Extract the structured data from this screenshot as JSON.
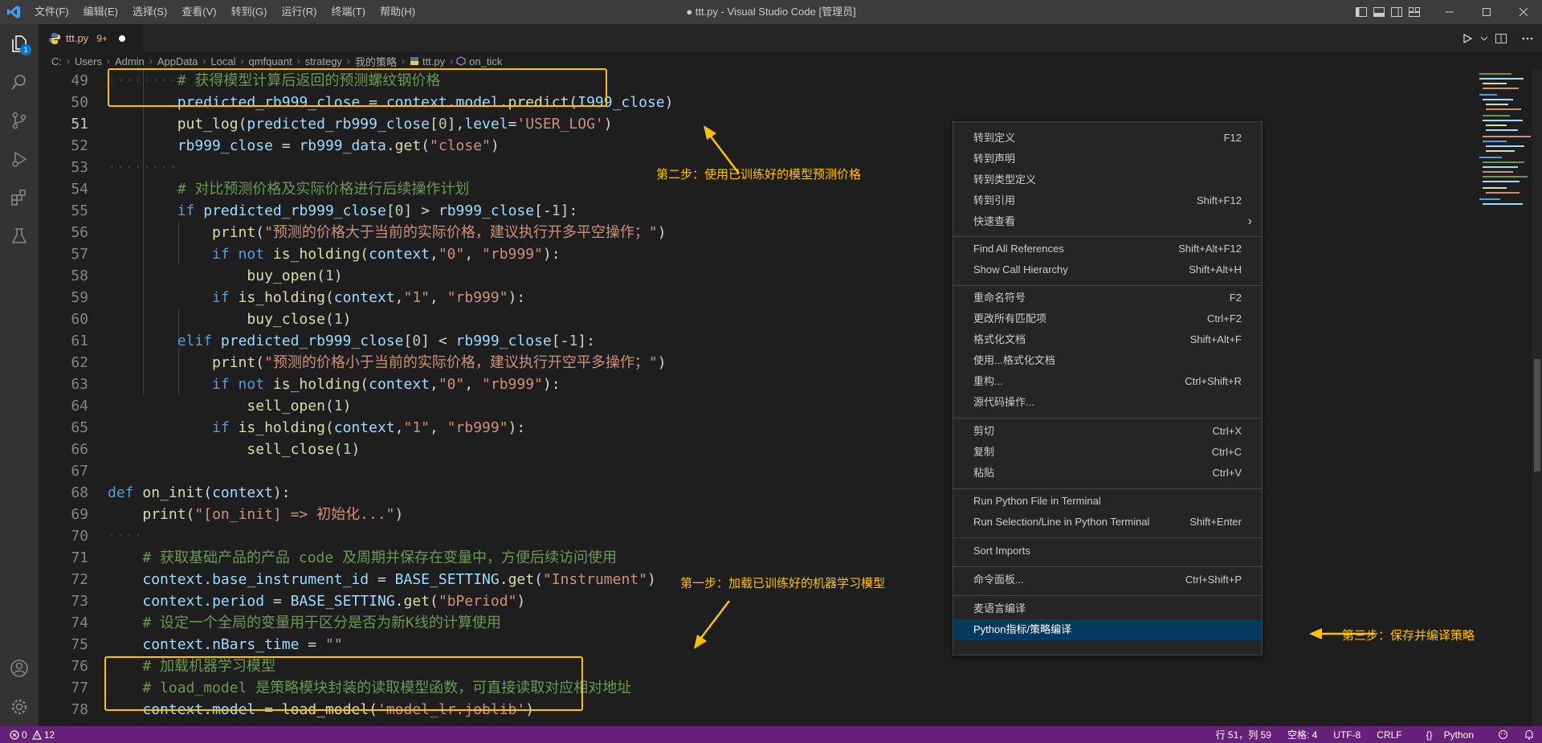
{
  "window": {
    "title": "● ttt.py - Visual Studio Code [管理员]",
    "menu": [
      "文件(F)",
      "编辑(E)",
      "选择(S)",
      "查看(V)",
      "转到(G)",
      "运行(R)",
      "终端(T)",
      "帮助(H)"
    ]
  },
  "activity_bar": {
    "explorer_badge": "1"
  },
  "tab": {
    "filename": "ttt.py",
    "problems": "9+"
  },
  "breadcrumb": [
    "C:",
    "Users",
    "Admin",
    "AppData",
    "Local",
    "qmfquant",
    "strategy",
    "我的策略",
    "ttt.py",
    "on_tick"
  ],
  "editor": {
    "lines": [
      49,
      50,
      51,
      52,
      53,
      54,
      55,
      56,
      57,
      58,
      59,
      60,
      61,
      62,
      63,
      64,
      65,
      66,
      67,
      68,
      69,
      70,
      71,
      72,
      73,
      74,
      75,
      76,
      77,
      78
    ],
    "current_line": 51
  },
  "annotations": {
    "step1": "第一步：加载已训练好的机器学习模型",
    "step2": "第二步：使用已训练好的模型预测价格",
    "step3": "第三步：保存并编译策略"
  },
  "context_menu": {
    "groups": [
      [
        {
          "label": "转到定义",
          "key": "F12"
        },
        {
          "label": "转到声明",
          "key": ""
        },
        {
          "label": "转到类型定义",
          "key": ""
        },
        {
          "label": "转到引用",
          "key": "Shift+F12"
        },
        {
          "label": "快速查看",
          "key": "›"
        }
      ],
      [
        {
          "label": "Find All References",
          "key": "Shift+Alt+F12"
        },
        {
          "label": "Show Call Hierarchy",
          "key": "Shift+Alt+H"
        }
      ],
      [
        {
          "label": "重命名符号",
          "key": "F2"
        },
        {
          "label": "更改所有匹配项",
          "key": "Ctrl+F2"
        },
        {
          "label": "格式化文档",
          "key": "Shift+Alt+F"
        },
        {
          "label": "使用...格式化文档",
          "key": ""
        },
        {
          "label": "重构...",
          "key": "Ctrl+Shift+R"
        },
        {
          "label": "源代码操作...",
          "key": ""
        }
      ],
      [
        {
          "label": "剪切",
          "key": "Ctrl+X"
        },
        {
          "label": "复制",
          "key": "Ctrl+C"
        },
        {
          "label": "粘贴",
          "key": "Ctrl+V"
        }
      ],
      [
        {
          "label": "Run Python File in Terminal",
          "key": ""
        },
        {
          "label": "Run Selection/Line in Python Terminal",
          "key": "Shift+Enter"
        }
      ],
      [
        {
          "label": "Sort Imports",
          "key": ""
        }
      ],
      [
        {
          "label": "命令面板...",
          "key": "Ctrl+Shift+P"
        }
      ],
      [
        {
          "label": "麦语言编译",
          "key": ""
        },
        {
          "label": "Python指标/策略编译",
          "key": "",
          "selected": true
        }
      ]
    ]
  },
  "status_bar": {
    "errors": "0",
    "warnings": "12",
    "position": "行 51，列 59",
    "indent": "空格: 4",
    "encoding": "UTF-8",
    "eol": "CRLF",
    "language": "Python"
  },
  "colors": {
    "status_bar": "#68217a",
    "annotation": "#ffc000",
    "menu_selected": "#04395e"
  }
}
